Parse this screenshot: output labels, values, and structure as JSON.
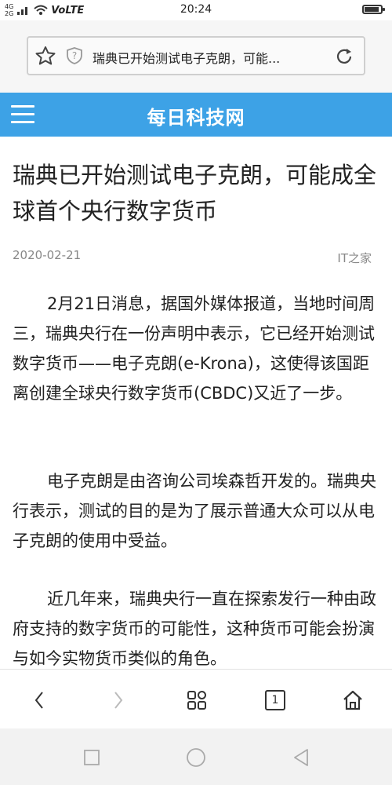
{
  "status_bar": {
    "signal_label": "4G",
    "signal_label2": "2G",
    "network_label": "VoLTE",
    "time": "20:24",
    "battery_level": 0.9
  },
  "url_bar": {
    "page_title": "瑞典已开始测试电子克朗，可能..."
  },
  "header": {
    "site_name": "每日科技网"
  },
  "article": {
    "title": "瑞典已开始测试电子克朗，可能成全球首个央行数字货币",
    "date": "2020-02-21",
    "source": "IT之家",
    "paragraphs": [
      "2月21日消息，据国外媒体报道，当地时间周三，瑞典央行在一份声明中表示，它已经开始测试数字货币——电子克朗(e-Krona)，这使得该国距离创建全球央行数字货币(CBDC)又近了一步。",
      "电子克朗是由咨询公司埃森哲开发的。瑞典央行表示，测试的目的是为了展示普通大众可以从电子克朗的使用中受益。",
      "近几年来，瑞典央行一直在探索发行一种由政府支持的数字货币的可能性，这种货币可能会扮演与如今实物货币类似的角色。"
    ]
  },
  "bottom_nav": {
    "tab_count": "1",
    "icons": [
      "back-icon",
      "forward-icon",
      "menu-grid-icon",
      "tabs-icon",
      "home-icon"
    ]
  },
  "system_nav": {
    "icons": [
      "recent-apps-icon",
      "home-circle-icon",
      "back-triangle-icon"
    ]
  },
  "colors": {
    "header_bg": "#3da2e6",
    "header_text": "#ffffff",
    "meta_text": "#888888"
  }
}
